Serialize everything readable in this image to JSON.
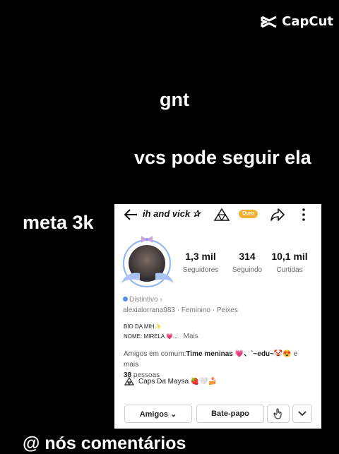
{
  "watermark": {
    "brand": "CapCut",
    "icon": "capcut-logo-icon"
  },
  "captions": {
    "line1": "gnt",
    "line2": "vcs pode seguir ela",
    "line3": "meta 3k",
    "line4": "@ nós comentários"
  },
  "profile": {
    "username": "ih and vick ✰",
    "badge": "Ouro",
    "stats": [
      {
        "value": "1,3 mil",
        "label": "Seguidores"
      },
      {
        "value": "314",
        "label": "Seguindo"
      },
      {
        "value": "10,1 mil",
        "label": "Curtidas"
      }
    ],
    "distintivo": "Distintivo ›",
    "meta_line": "alexialorrana983 · Feminino · Peixes",
    "bio_title": "BIO DA MIH✨",
    "bio_name": "NOME: MIRELA 💗...",
    "bio_more": "Mais",
    "amigos_prefix": "Amigos em comum:",
    "amigos_names": "Time meninas 💗、`~edu~🤡😍",
    "amigos_suffix": " e mais ",
    "amigos_count": "38",
    "amigos_end": " pessoas",
    "caps": "Caps Da Maysa 🍓🤍🍰"
  },
  "actions": {
    "amigos_button": "Amigos ⌄",
    "chat_button": "Bate-papo"
  },
  "colors": {
    "badge": "#f3b233",
    "avatar_ring": "#8bb1f5",
    "distintivo_dot": "#5a8cf0"
  }
}
